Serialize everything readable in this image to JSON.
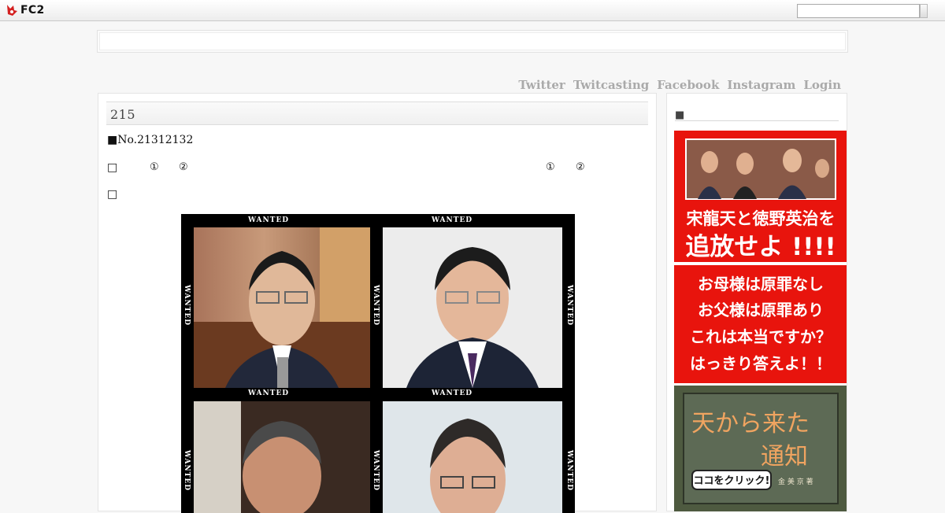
{
  "topbar": {
    "logo_text": "FC2",
    "search_value": ""
  },
  "nav": {
    "items": [
      "Twitter",
      "Twitcasting",
      "Facebook",
      "Instagram",
      "Login"
    ]
  },
  "post": {
    "title": "215",
    "line1": "■No.21312132",
    "line2_marks": [
      "□",
      "①",
      "②",
      "①",
      "②"
    ],
    "line3": "□",
    "wanted_label": "WANTED"
  },
  "sidebar": {
    "title": "■",
    "ad1": {
      "line1": "宋龍天と徳野英治を",
      "line2": "追放せよ !!!!"
    },
    "ad2": {
      "lines": [
        "お母様は原罪なし",
        "お父様は原罪あり",
        "これは本当ですか？",
        "はっきり答えよ！！"
      ]
    },
    "ad3": {
      "title_line1": "天から来た",
      "title_line2": "通知",
      "button": "ココをクリック!",
      "author": "金 美 京 著"
    }
  },
  "colors": {
    "ad_red": "#e8140d",
    "nav_gray": "#aaaaaa"
  }
}
